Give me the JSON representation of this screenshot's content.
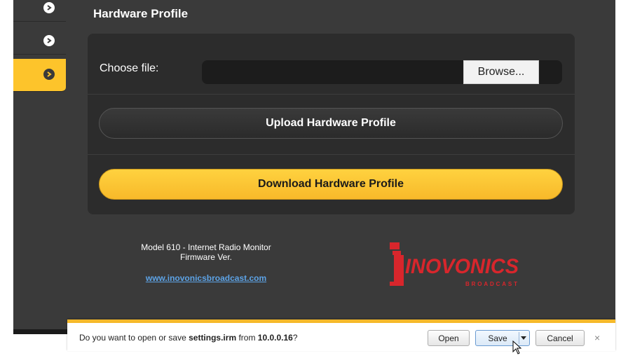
{
  "sidebar": {
    "items": [
      {
        "icon": "chevron-right-icon"
      },
      {
        "icon": "chevron-right-icon"
      },
      {
        "icon": "chevron-right-icon",
        "active": true
      }
    ]
  },
  "page": {
    "title": "Hardware Profile"
  },
  "panel": {
    "choose_label": "Choose file:",
    "browse_label": "Browse...",
    "upload_label": "Upload Hardware Profile",
    "download_label": "Download Hardware Profile"
  },
  "footer": {
    "model": "Model 610 - Internet Radio Monitor",
    "firmware": "Firmware Ver.",
    "link": "www.inovonicsbroadcast.com"
  },
  "logo": {
    "name": "INOVONICS",
    "sub": "BROADCAST",
    "color": "#d8262c"
  },
  "download_bar": {
    "prefix": "Do you want to open or save ",
    "filename": "settings.irm",
    "middle": " from ",
    "host": "10.0.0.16",
    "suffix": "?",
    "open_label": "Open",
    "save_label": "Save",
    "cancel_label": "Cancel",
    "close_label": "×"
  },
  "colors": {
    "accent": "#fdc42b",
    "background": "#3a3a3a",
    "panel": "#2c2c2c",
    "link": "#5da3e6"
  }
}
